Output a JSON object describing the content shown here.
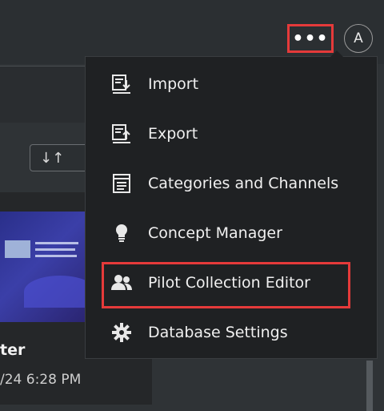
{
  "header": {
    "more_label": "•••",
    "avatar_initial": "A"
  },
  "menu": {
    "items": [
      {
        "label": "Import",
        "icon": "import-icon"
      },
      {
        "label": "Export",
        "icon": "export-icon"
      },
      {
        "label": "Categories and Channels",
        "icon": "categories-icon"
      },
      {
        "label": "Concept Manager",
        "icon": "lightbulb-icon"
      },
      {
        "label": "Pilot Collection Editor",
        "icon": "users-icon"
      },
      {
        "label": "Database Settings",
        "icon": "gear-icon"
      }
    ]
  },
  "card": {
    "title": "ter",
    "date": "/24 6:28 PM"
  },
  "toolbar": {
    "sort_icon": "sort-arrows-icon",
    "sort_glyph": "↓↑"
  },
  "colors": {
    "highlight": "#e53a3a",
    "menu_bg": "#1f2123"
  }
}
